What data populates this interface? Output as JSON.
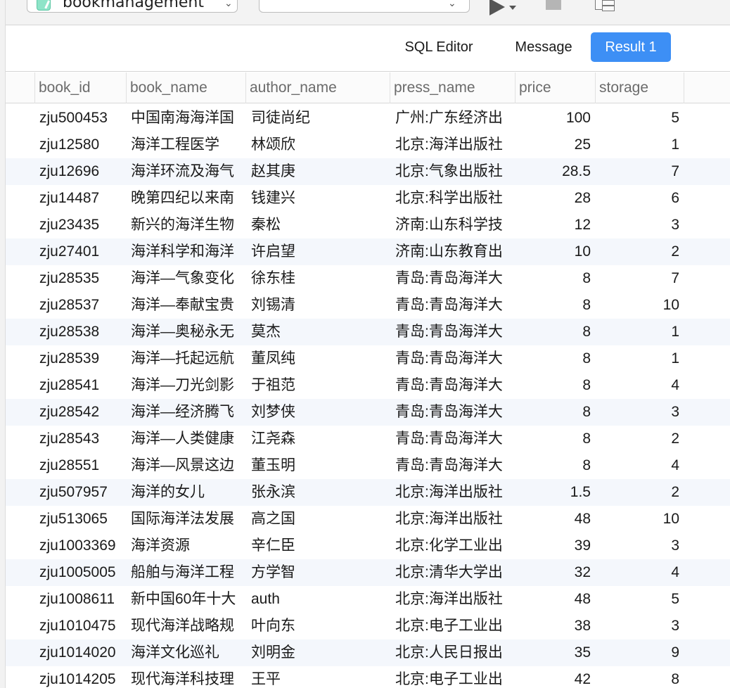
{
  "toolbar": {
    "database": "bookmanagement",
    "query": "",
    "icons": {
      "database": "database-icon",
      "run": "play-icon",
      "stop": "stop-icon",
      "layout": "layout-icon"
    }
  },
  "tabs": [
    "SQL Editor",
    "Message",
    "Result 1"
  ],
  "active_tab": "Result 1",
  "colors": {
    "accent": "#3d8ff5",
    "row_alt": "#f4f7fc"
  },
  "table": {
    "columns": [
      "book_id",
      "book_name",
      "author_name",
      "press_name",
      "price",
      "storage"
    ],
    "rows": [
      [
        "zju500453",
        "中国南海海洋国",
        "司徒尚纪",
        "广州:广东经济出",
        "100",
        "5"
      ],
      [
        "zju12580",
        "海洋工程医学",
        "林颂欣",
        "北京:海洋出版社",
        "25",
        "1"
      ],
      [
        "zju12696",
        "海洋环流及海气",
        "赵其庚",
        "北京:气象出版社",
        "28.5",
        "7"
      ],
      [
        "zju14487",
        "晚第四纪以来南",
        "钱建兴",
        "北京:科学出版社",
        "28",
        "6"
      ],
      [
        "zju23435",
        "新兴的海洋生物",
        "秦松",
        "济南:山东科学技",
        "12",
        "3"
      ],
      [
        "zju27401",
        "海洋科学和海洋",
        "许启望",
        "济南:山东教育出",
        "10",
        "2"
      ],
      [
        "zju28535",
        "海洋—气象变化",
        "徐东桂",
        "青岛:青岛海洋大",
        "8",
        "7"
      ],
      [
        "zju28537",
        "海洋—奉献宝贵",
        "刘锡清",
        "青岛:青岛海洋大",
        "8",
        "10"
      ],
      [
        "zju28538",
        "海洋—奥秘永无",
        "莫杰",
        "青岛:青岛海洋大",
        "8",
        "1"
      ],
      [
        "zju28539",
        "海洋—托起远航",
        "董凤纯",
        "青岛:青岛海洋大",
        "8",
        "1"
      ],
      [
        "zju28541",
        "海洋—刀光剑影",
        "于祖范",
        "青岛:青岛海洋大",
        "8",
        "4"
      ],
      [
        "zju28542",
        "海洋—经济腾飞",
        "刘梦侠",
        "青岛:青岛海洋大",
        "8",
        "3"
      ],
      [
        "zju28543",
        "海洋—人类健康",
        "江尧森",
        "青岛:青岛海洋大",
        "8",
        "2"
      ],
      [
        "zju28551",
        "海洋—风景这边",
        "董玉明",
        "青岛:青岛海洋大",
        "8",
        "4"
      ],
      [
        "zju507957",
        "海洋的女儿",
        "张永滨",
        "北京:海洋出版社",
        "1.5",
        "2"
      ],
      [
        "zju513065",
        "国际海洋法发展",
        "高之国",
        "北京:海洋出版社",
        "48",
        "10"
      ],
      [
        "zju1003369",
        "海洋资源",
        "辛仁臣",
        "北京:化学工业出",
        "39",
        "3"
      ],
      [
        "zju1005005",
        "船舶与海洋工程",
        "方学智",
        "北京:清华大学出",
        "32",
        "4"
      ],
      [
        "zju1008611",
        "新中国60年十大",
        "auth",
        "北京:海洋出版社",
        "48",
        "5"
      ],
      [
        "zju1010475",
        "现代海洋战略规",
        "叶向东",
        "北京:电子工业出",
        "38",
        "3"
      ],
      [
        "zju1014020",
        "海洋文化巡礼",
        "刘明金",
        "北京:人民日报出",
        "35",
        "9"
      ],
      [
        "zju1014205",
        "现代海洋科技理",
        "王平",
        "北京:电子工业出",
        "42",
        "8"
      ]
    ]
  }
}
